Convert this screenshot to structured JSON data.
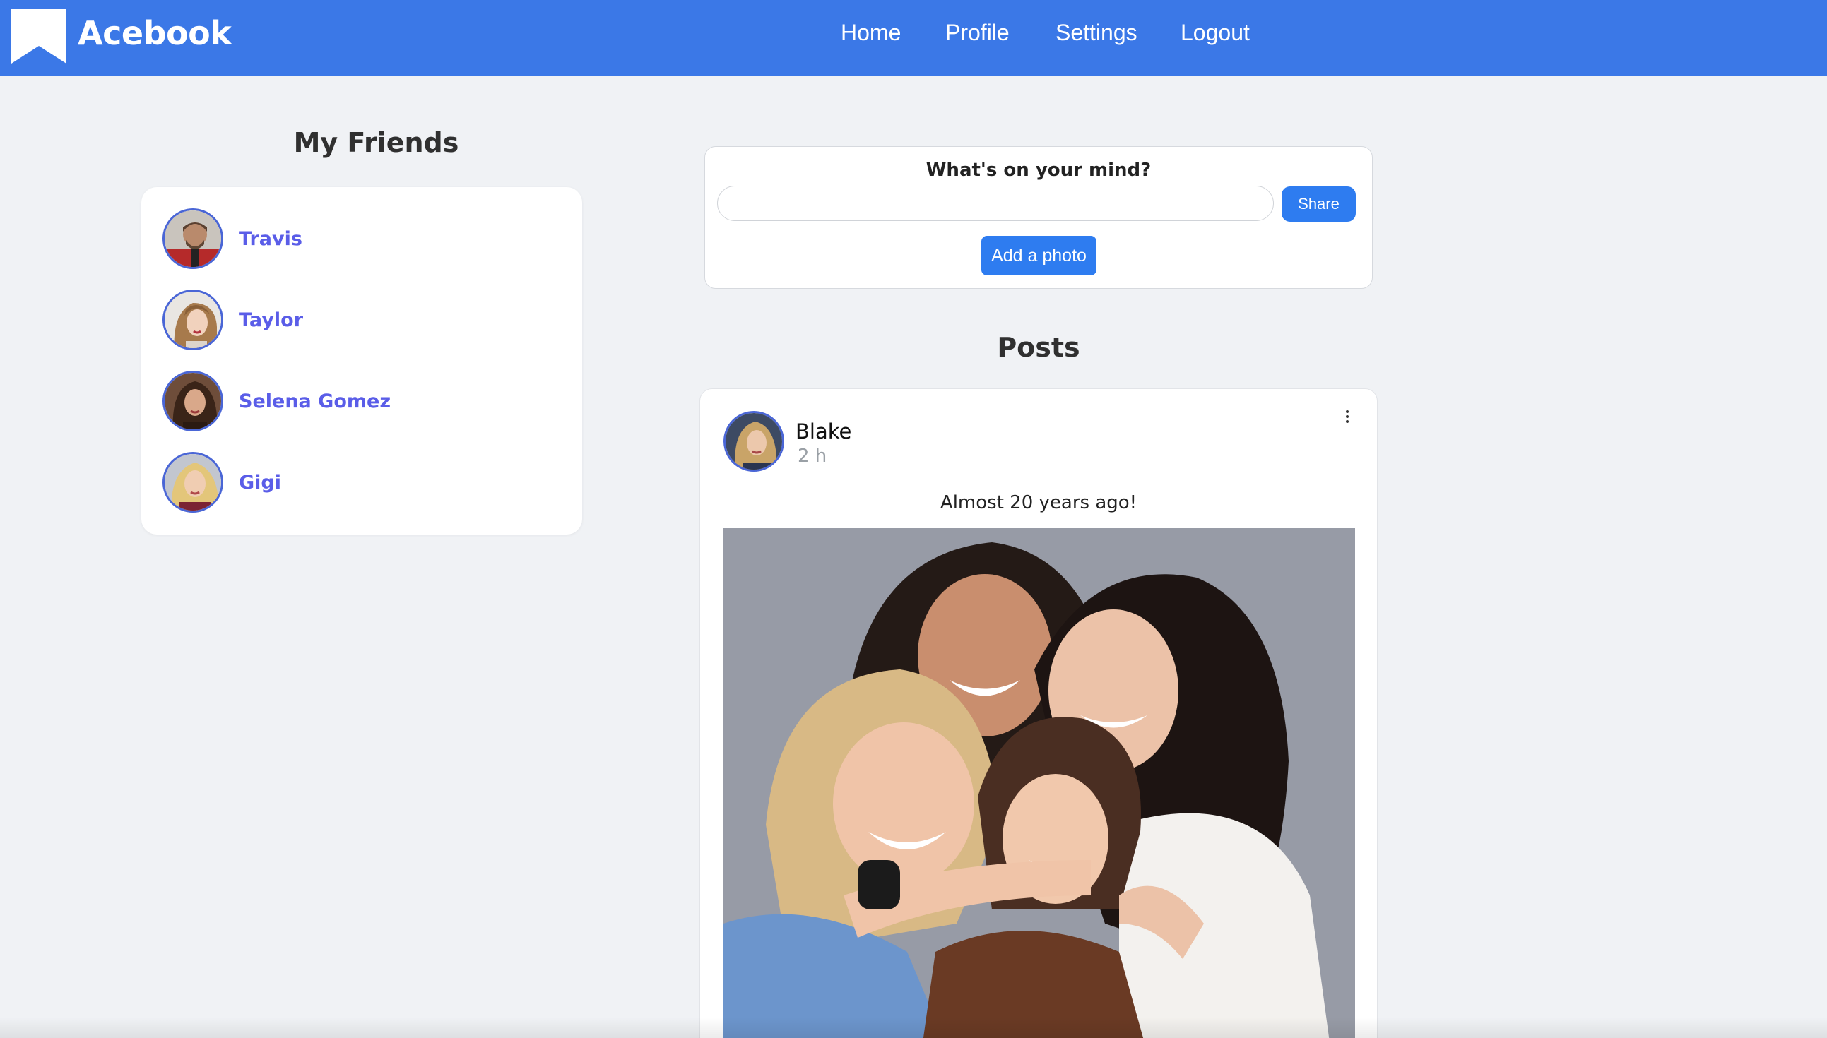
{
  "brand": {
    "name": "Acebook",
    "logo_icon": "bookmark-icon",
    "bar_color": "#3b78e7"
  },
  "nav": {
    "items": [
      "Home",
      "Profile",
      "Settings",
      "Logout"
    ]
  },
  "friends": {
    "title": "My Friends",
    "items": [
      {
        "name": "Travis"
      },
      {
        "name": "Taylor"
      },
      {
        "name": "Selena Gomez"
      },
      {
        "name": "Gigi"
      }
    ]
  },
  "composer": {
    "title": "What's on your mind?",
    "input_value": "",
    "input_placeholder": "",
    "share_label": "Share",
    "photo_label": "Add a photo",
    "button_color": "#2e7cf0"
  },
  "posts": {
    "title": "Posts",
    "items": [
      {
        "author": "Blake",
        "time": "2 h",
        "text": "Almost 20 years ago!",
        "menu_icon": "more-vertical-icon"
      }
    ]
  }
}
